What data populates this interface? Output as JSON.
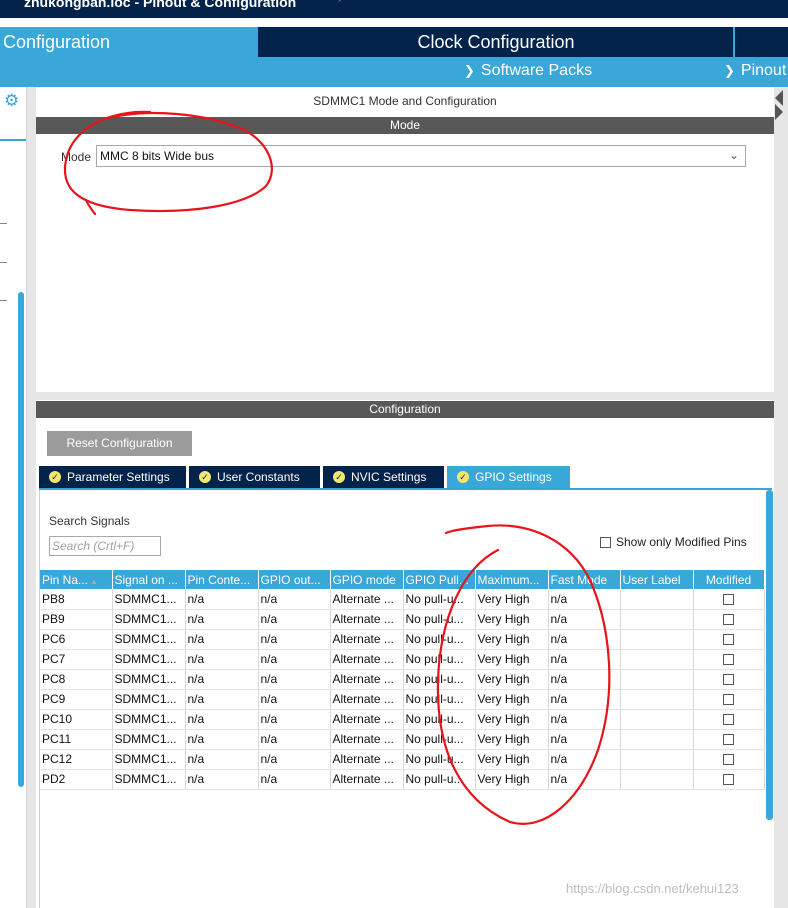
{
  "window": {
    "title": "zhukongban.ioc - Pinout & Configuration"
  },
  "main_tabs": [
    {
      "label": "Configuration",
      "active": true
    },
    {
      "label": "Clock Configuration",
      "active": false
    }
  ],
  "sub_tabs": [
    {
      "label": "Software Packs",
      "icon": "chevron-down-icon"
    },
    {
      "label": "Pinout",
      "icon": "chevron-down-icon"
    }
  ],
  "mode_panel": {
    "title": "SDMMC1 Mode and Configuration",
    "header": "Mode",
    "mode_label": "Mode",
    "mode_value": "MMC 8 bits Wide bus"
  },
  "config_panel": {
    "header": "Configuration",
    "reset_button": "Reset Configuration",
    "tabs": [
      {
        "label": "Parameter Settings",
        "active": false
      },
      {
        "label": "User Constants",
        "active": false
      },
      {
        "label": "NVIC Settings",
        "active": false
      },
      {
        "label": "GPIO Settings",
        "active": true
      }
    ],
    "search_label": "Search Signals",
    "search_placeholder": "Search (Crtl+F)",
    "show_modified_label": "Show only Modified Pins",
    "table": {
      "headers": [
        "Pin Na...",
        "Signal on ...",
        "Pin Conte...",
        "GPIO out...",
        "GPIO mode",
        "GPIO Pull...",
        "Maximum...",
        "Fast Mode",
        "User Label",
        "Modified"
      ],
      "rows": [
        [
          "PB8",
          "SDMMC1...",
          "n/a",
          "n/a",
          "Alternate ...",
          "No pull-u...",
          "Very High",
          "n/a",
          "",
          ""
        ],
        [
          "PB9",
          "SDMMC1...",
          "n/a",
          "n/a",
          "Alternate ...",
          "No pull-u...",
          "Very High",
          "n/a",
          "",
          ""
        ],
        [
          "PC6",
          "SDMMC1...",
          "n/a",
          "n/a",
          "Alternate ...",
          "No pull-u...",
          "Very High",
          "n/a",
          "",
          ""
        ],
        [
          "PC7",
          "SDMMC1...",
          "n/a",
          "n/a",
          "Alternate ...",
          "No pull-u...",
          "Very High",
          "n/a",
          "",
          ""
        ],
        [
          "PC8",
          "SDMMC1...",
          "n/a",
          "n/a",
          "Alternate ...",
          "No pull-u...",
          "Very High",
          "n/a",
          "",
          ""
        ],
        [
          "PC9",
          "SDMMC1...",
          "n/a",
          "n/a",
          "Alternate ...",
          "No pull-u...",
          "Very High",
          "n/a",
          "",
          ""
        ],
        [
          "PC10",
          "SDMMC1...",
          "n/a",
          "n/a",
          "Alternate ...",
          "No pull-u...",
          "Very High",
          "n/a",
          "",
          ""
        ],
        [
          "PC11",
          "SDMMC1...",
          "n/a",
          "n/a",
          "Alternate ...",
          "No pull-u...",
          "Very High",
          "n/a",
          "",
          ""
        ],
        [
          "PC12",
          "SDMMC1...",
          "n/a",
          "n/a",
          "Alternate ...",
          "No pull-u...",
          "Very High",
          "n/a",
          "",
          ""
        ],
        [
          "PD2",
          "SDMMC1...",
          "n/a",
          "n/a",
          "Alternate ...",
          "No pull-u...",
          "Very High",
          "n/a",
          "",
          ""
        ]
      ]
    }
  },
  "watermark": "https://blog.csdn.net/kehui123",
  "colors": {
    "accent": "#3aa7d9",
    "navy": "#03234b",
    "panel_header": "#585858",
    "annotation": "#e8141a"
  }
}
